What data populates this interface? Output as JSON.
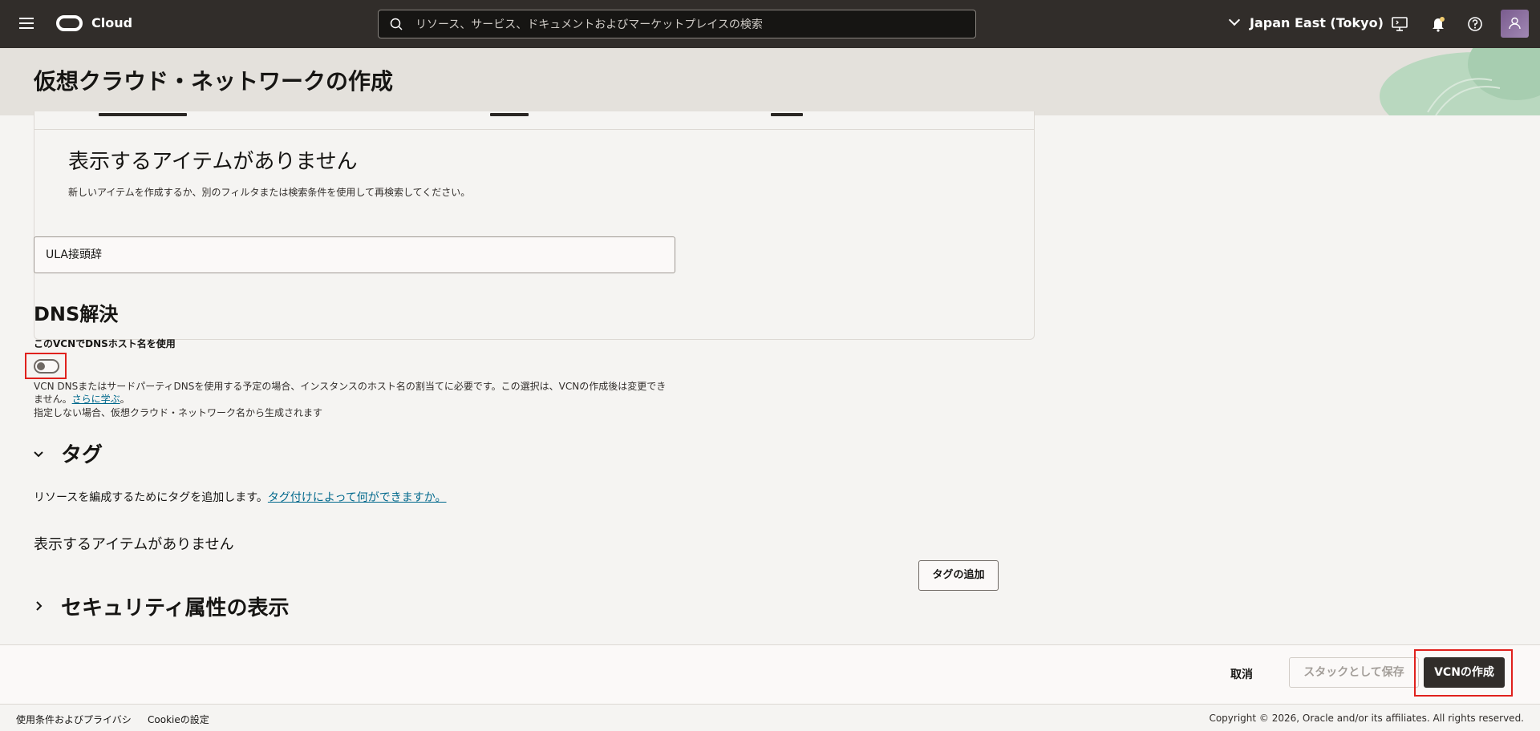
{
  "topbar": {
    "brand": "Cloud",
    "search_placeholder": "リソース、サービス、ドキュメントおよびマーケットプレイスの検索",
    "region": "Japan East (Tokyo)"
  },
  "page": {
    "title": "仮想クラウド・ネットワークの作成"
  },
  "ipv6_table": {
    "empty_title": "表示するアイテムがありません",
    "empty_subtitle": "新しいアイテムを作成するか、別のフィルタまたは検索条件を使用して再検索してください。"
  },
  "ula_field": {
    "value": "ULA接頭辞"
  },
  "dns": {
    "heading": "DNS解決",
    "toggle_label": "このVCNでDNSホスト名を使用",
    "toggle_on": false,
    "help_text": "VCN DNSまたはサードパーティDNSを使用する予定の場合、インスタンスのホスト名の割当てに必要です。この選択は、VCNの作成後は変更できません。",
    "help_link": "さらに学ぶ",
    "help_link_suffix": "。",
    "note": "指定しない場合、仮想クラウド・ネットワーク名から生成されます"
  },
  "tags": {
    "heading": "タグ",
    "description": "リソースを編成するためにタグを追加します。",
    "link": "タグ付けによって何ができますか。",
    "empty": "表示するアイテムがありません",
    "add_button": "タグの追加"
  },
  "security": {
    "heading": "セキュリティ属性の表示"
  },
  "actions": {
    "cancel": "取消",
    "save_stack": "スタックとして保存",
    "create": "VCNの作成"
  },
  "footer": {
    "terms": "使用条件およびプライバシ",
    "cookies": "Cookieの設定",
    "copyright": "Copyright © 2026, Oracle and/or its affiliates. All rights reserved."
  },
  "colors": {
    "highlight": "#e0211d",
    "topbar": "#312d2a",
    "link": "#00688c"
  }
}
